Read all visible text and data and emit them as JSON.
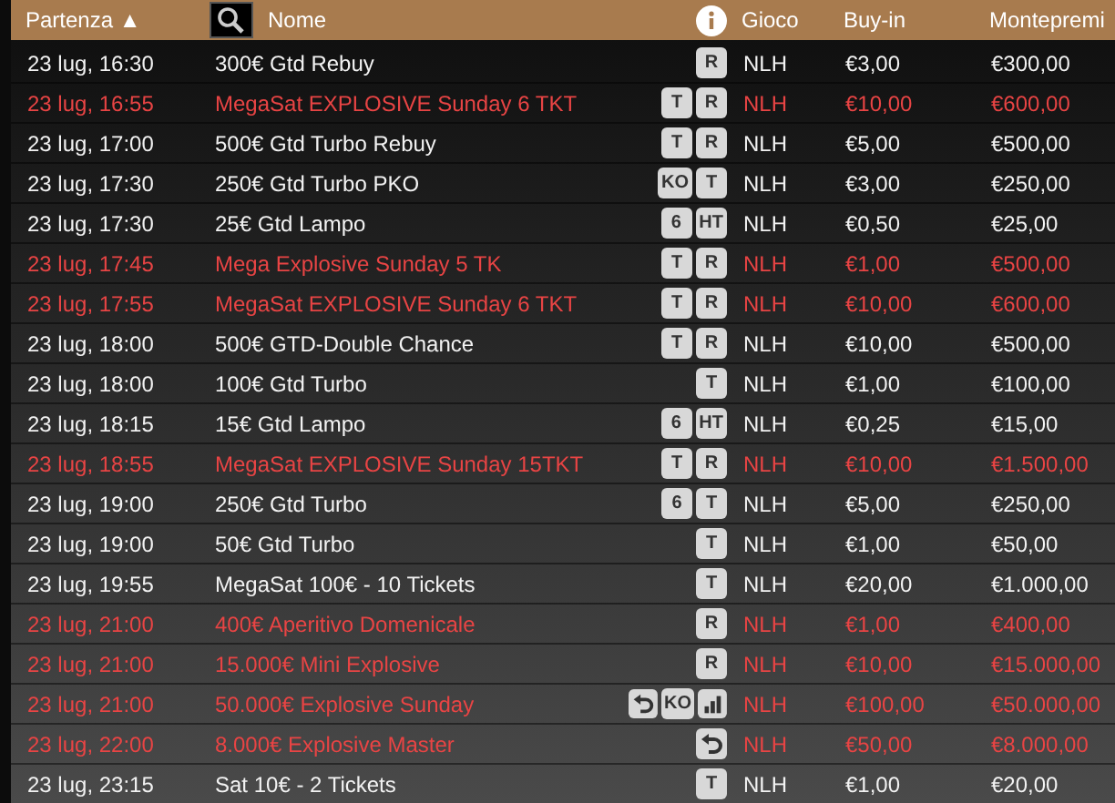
{
  "header": {
    "columns": [
      {
        "kind": "sort",
        "label": "Partenza",
        "sort_mark": "▲"
      },
      {
        "kind": "search",
        "label": "Nome"
      },
      {
        "kind": "info"
      },
      {
        "kind": "text",
        "label": "Gioco"
      },
      {
        "kind": "text",
        "label": "Buy-in"
      },
      {
        "kind": "text",
        "label": "Montepremi"
      }
    ]
  },
  "rows": [
    {
      "start": "23 lug, 16:30",
      "name": "300€ Gtd Rebuy",
      "highlighted": false,
      "badges": [
        {
          "kind": "letter",
          "text": "R"
        }
      ],
      "game": "NLH",
      "buyin": "€3,00",
      "prize": "€300,00"
    },
    {
      "start": "23 lug, 16:55",
      "name": "MegaSat EXPLOSIVE Sunday 6 TKT",
      "highlighted": true,
      "badges": [
        {
          "kind": "letter",
          "text": "T"
        },
        {
          "kind": "letter",
          "text": "R"
        }
      ],
      "game": "NLH",
      "buyin": "€10,00",
      "prize": "€600,00"
    },
    {
      "start": "23 lug, 17:00",
      "name": "500€ Gtd Turbo Rebuy",
      "highlighted": false,
      "badges": [
        {
          "kind": "letter",
          "text": "T"
        },
        {
          "kind": "letter",
          "text": "R"
        }
      ],
      "game": "NLH",
      "buyin": "€5,00",
      "prize": "€500,00"
    },
    {
      "start": "23 lug, 17:30",
      "name": "250€ Gtd Turbo PKO",
      "highlighted": false,
      "badges": [
        {
          "kind": "letter",
          "text": "KO"
        },
        {
          "kind": "letter",
          "text": "T"
        }
      ],
      "game": "NLH",
      "buyin": "€3,00",
      "prize": "€250,00"
    },
    {
      "start": "23 lug, 17:30",
      "name": "25€ Gtd Lampo",
      "highlighted": false,
      "badges": [
        {
          "kind": "letter",
          "text": "6"
        },
        {
          "kind": "letter",
          "text": "HT"
        }
      ],
      "game": "NLH",
      "buyin": "€0,50",
      "prize": "€25,00"
    },
    {
      "start": "23 lug, 17:45",
      "name": "Mega Explosive Sunday 5 TK",
      "highlighted": true,
      "badges": [
        {
          "kind": "letter",
          "text": "T"
        },
        {
          "kind": "letter",
          "text": "R"
        }
      ],
      "game": "NLH",
      "buyin": "€1,00",
      "prize": "€500,00"
    },
    {
      "start": "23 lug, 17:55",
      "name": "MegaSat EXPLOSIVE Sunday 6 TKT",
      "highlighted": true,
      "badges": [
        {
          "kind": "letter",
          "text": "T"
        },
        {
          "kind": "letter",
          "text": "R"
        }
      ],
      "game": "NLH",
      "buyin": "€10,00",
      "prize": "€600,00"
    },
    {
      "start": "23 lug, 18:00",
      "name": "500€ GTD-Double Chance",
      "highlighted": false,
      "badges": [
        {
          "kind": "letter",
          "text": "T"
        },
        {
          "kind": "letter",
          "text": "R"
        }
      ],
      "game": "NLH",
      "buyin": "€10,00",
      "prize": "€500,00"
    },
    {
      "start": "23 lug, 18:00",
      "name": "100€ Gtd Turbo",
      "highlighted": false,
      "badges": [
        {
          "kind": "letter",
          "text": "T"
        }
      ],
      "game": "NLH",
      "buyin": "€1,00",
      "prize": "€100,00"
    },
    {
      "start": "23 lug, 18:15",
      "name": "15€ Gtd Lampo",
      "highlighted": false,
      "badges": [
        {
          "kind": "letter",
          "text": "6"
        },
        {
          "kind": "letter",
          "text": "HT"
        }
      ],
      "game": "NLH",
      "buyin": "€0,25",
      "prize": "€15,00"
    },
    {
      "start": "23 lug, 18:55",
      "name": "MegaSat EXPLOSIVE Sunday 15TKT",
      "highlighted": true,
      "badges": [
        {
          "kind": "letter",
          "text": "T"
        },
        {
          "kind": "letter",
          "text": "R"
        }
      ],
      "game": "NLH",
      "buyin": "€10,00",
      "prize": "€1.500,00"
    },
    {
      "start": "23 lug, 19:00",
      "name": "250€ Gtd Turbo",
      "highlighted": false,
      "badges": [
        {
          "kind": "letter",
          "text": "6"
        },
        {
          "kind": "letter",
          "text": "T"
        }
      ],
      "game": "NLH",
      "buyin": "€5,00",
      "prize": "€250,00"
    },
    {
      "start": "23 lug, 19:00",
      "name": "50€ Gtd Turbo",
      "highlighted": false,
      "badges": [
        {
          "kind": "letter",
          "text": "T"
        }
      ],
      "game": "NLH",
      "buyin": "€1,00",
      "prize": "€50,00"
    },
    {
      "start": "23 lug, 19:55",
      "name": "MegaSat 100€ - 10 Tickets",
      "highlighted": false,
      "badges": [
        {
          "kind": "letter",
          "text": "T"
        }
      ],
      "game": "NLH",
      "buyin": "€20,00",
      "prize": "€1.000,00"
    },
    {
      "start": "23 lug, 21:00",
      "name": "400€ Aperitivo Domenicale",
      "highlighted": true,
      "badges": [
        {
          "kind": "letter",
          "text": "R"
        }
      ],
      "game": "NLH",
      "buyin": "€1,00",
      "prize": "€400,00"
    },
    {
      "start": "23 lug, 21:00",
      "name": "15.000€ Mini Explosive",
      "highlighted": true,
      "badges": [
        {
          "kind": "letter",
          "text": "R"
        }
      ],
      "game": "NLH",
      "buyin": "€10,00",
      "prize": "€15.000,00"
    },
    {
      "start": "23 lug, 21:00",
      "name": "50.000€ Explosive Sunday",
      "highlighted": true,
      "badges": [
        {
          "kind": "reentry"
        },
        {
          "kind": "letter",
          "text": "KO"
        },
        {
          "kind": "bars"
        }
      ],
      "game": "NLH",
      "buyin": "€100,00",
      "prize": "€50.000,00"
    },
    {
      "start": "23 lug, 22:00",
      "name": "8.000€ Explosive Master",
      "highlighted": true,
      "badges": [
        {
          "kind": "reentry"
        }
      ],
      "game": "NLH",
      "buyin": "€50,00",
      "prize": "€8.000,00"
    },
    {
      "start": "23 lug, 23:15",
      "name": "Sat 10€ - 2 Tickets",
      "highlighted": false,
      "badges": [
        {
          "kind": "letter",
          "text": "T"
        }
      ],
      "game": "NLH",
      "buyin": "€1,00",
      "prize": "€20,00"
    }
  ]
}
